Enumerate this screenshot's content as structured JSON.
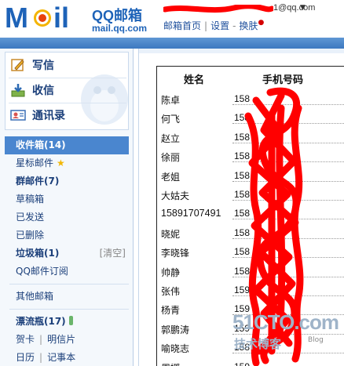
{
  "header": {
    "logo_text": "MOil",
    "brand": "QQ邮箱",
    "url": "mail.qq.com",
    "account_domain": "1@qq.com",
    "links": [
      "邮箱首页",
      "设置",
      "换肤"
    ],
    "separators": [
      "|",
      "-"
    ]
  },
  "quick_actions": [
    {
      "label": "写信",
      "icon": "write-icon"
    },
    {
      "label": "收信",
      "icon": "inbox-download-icon"
    },
    {
      "label": "通讯录",
      "icon": "contacts-card-icon"
    }
  ],
  "folders": {
    "inbox": "收件箱(14)",
    "starred": "星标邮件",
    "group": "群邮件(7)",
    "drafts": "草稿箱",
    "sent": "已发送",
    "deleted": "已删除",
    "spam": "垃圾箱(1)",
    "spam_clear": "[清空]",
    "subscriptions": "QQ邮件订阅",
    "other": "其他邮箱",
    "drift_bottle": "漂流瓶(17)",
    "card": "贺卡",
    "postcard": "明信片",
    "calendar": "日历",
    "notebook": "记事本",
    "pipe": "|"
  },
  "table": {
    "headers": {
      "name": "姓名",
      "phone": "手机号码"
    },
    "rows": [
      {
        "name": "陈卓",
        "phone": "158"
      },
      {
        "name": "何飞",
        "phone": "158"
      },
      {
        "name": "赵立",
        "phone": "158"
      },
      {
        "name": "徐丽",
        "phone": "158"
      },
      {
        "name": "老姐",
        "phone": "158"
      },
      {
        "name": "大姑夫",
        "phone": "158"
      },
      {
        "name": "15891707491",
        "phone": "158"
      },
      {
        "name": "晓妮",
        "phone": "158"
      },
      {
        "name": "李晓锋",
        "phone": "158"
      },
      {
        "name": "帅静",
        "phone": "158"
      },
      {
        "name": "张伟",
        "phone": "159"
      },
      {
        "name": "杨青",
        "phone": "159"
      },
      {
        "name": "郭鹏涛",
        "phone": "159"
      },
      {
        "name": "喻晓志",
        "phone": "158"
      },
      {
        "name": "周娜",
        "phone": "159"
      }
    ]
  },
  "watermark": {
    "main": "51CTO.com",
    "sub": "技术博客",
    "blog": "Blog"
  },
  "colors": {
    "brand_blue": "#1e63b8",
    "band_blue": "#3c78c0",
    "selected_folder": "#4a86cf",
    "scribble_red": "#ff0000"
  }
}
